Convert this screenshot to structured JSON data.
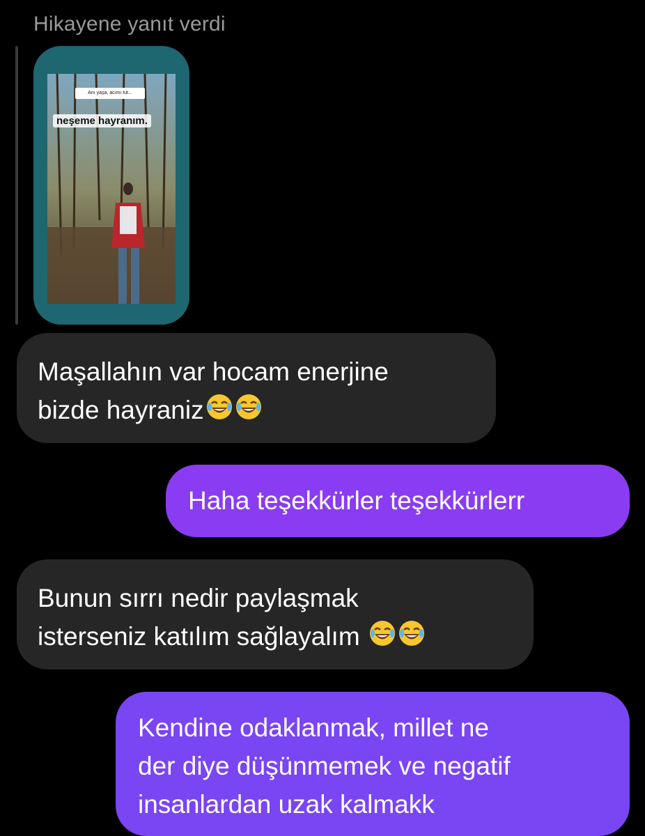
{
  "reply_header": "Hikayene yanıt verdi",
  "story": {
    "small_caption": "Anı yaşa, acımı tut...",
    "big_caption": "neşeme hayranım."
  },
  "messages": [
    {
      "side": "incoming",
      "text": "Maşallahın var hocam enerjine\nbizde hayraniz",
      "emoji": [
        "face-with-tears-of-joy-icon",
        "face-with-tears-of-joy-icon"
      ]
    },
    {
      "side": "outgoing",
      "text": "Haha teşekkürler teşekkürlerr",
      "color": "#8a3cf2"
    },
    {
      "side": "incoming",
      "text": "Bunun sırrı nedir paylaşmak\nisterseniz katılım sağlayalım ",
      "emoji": [
        "face-with-tears-of-joy-icon",
        "face-with-tears-of-joy-icon"
      ]
    },
    {
      "side": "outgoing",
      "text": "Kendine odaklanmak, millet ne\nder diye düşünmemek ve negatif\ninsanlardan uzak kalmakk",
      "color": "#7a45f3"
    }
  ],
  "colors": {
    "background": "#000000",
    "incoming_bubble": "#262626",
    "header_text": "#9a9a9a"
  }
}
